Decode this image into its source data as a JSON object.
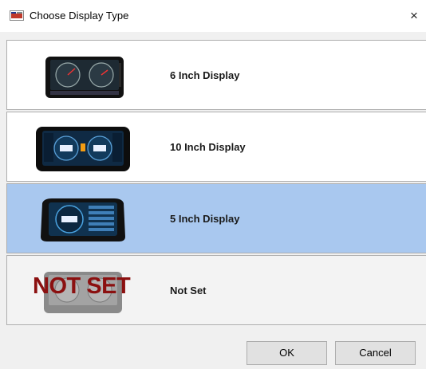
{
  "window": {
    "title": "Choose Display Type",
    "close_glyph": "×"
  },
  "options": [
    {
      "label": "6 Inch Display",
      "icon": "6-inch-display-thumbnail",
      "selected": false
    },
    {
      "label": "10 Inch Display",
      "icon": "10-inch-display-thumbnail",
      "selected": false
    },
    {
      "label": "5 Inch Display",
      "icon": "5-inch-display-thumbnail",
      "selected": true
    },
    {
      "label": "Not Set",
      "icon": "not-set-thumbnail",
      "overlay_text": "NOT SET",
      "selected": false
    }
  ],
  "buttons": {
    "ok": "OK",
    "cancel": "Cancel"
  },
  "colors": {
    "selection": "#a9c8ef",
    "window_bg": "#f0f0f0",
    "not_set_red": "#8b1010"
  }
}
